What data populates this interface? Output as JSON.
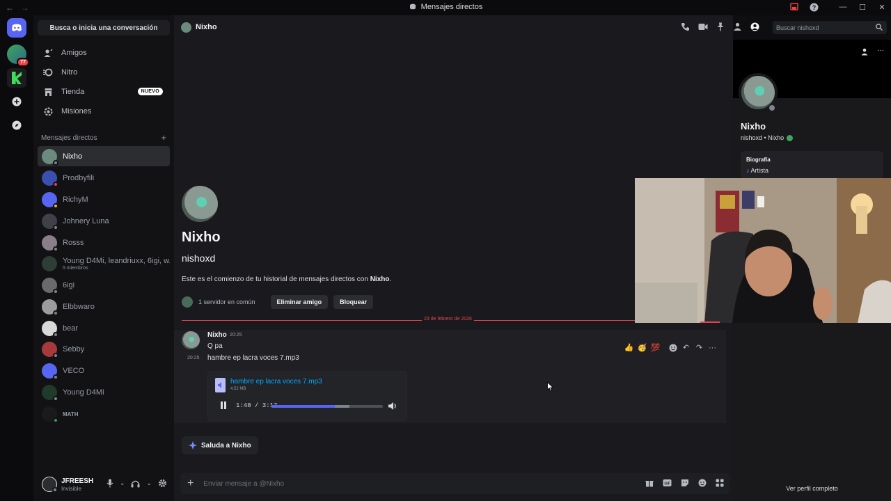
{
  "titlebar": {
    "title": "Mensajes directos"
  },
  "rail": {
    "items": [
      {
        "name": "discord-home",
        "badge": ""
      },
      {
        "name": "server-1",
        "badge": "77"
      },
      {
        "name": "server-2",
        "badge": ""
      },
      {
        "name": "add-server",
        "badge": ""
      },
      {
        "name": "discover",
        "badge": ""
      }
    ]
  },
  "sidebar": {
    "search_label": "Busca o inicia una conversación",
    "nav": [
      {
        "label": "Amigos",
        "icon": "friends-icon"
      },
      {
        "label": "Nitro",
        "icon": "nitro-icon"
      },
      {
        "label": "Tienda",
        "icon": "shop-icon",
        "badge": "NUEVO"
      },
      {
        "label": "Misiones",
        "icon": "quests-icon"
      }
    ],
    "dm_header": "Mensajes directos",
    "dms": [
      {
        "name": "Nixho",
        "sub": "",
        "color": "#6c8b7f",
        "status": "#80848e"
      },
      {
        "name": "Prodbyfili",
        "sub": "",
        "color": "#3a4fb0",
        "status": "#f23f43"
      },
      {
        "name": "RichyM",
        "sub": "",
        "color": "#5865f2",
        "status": "#f0b232"
      },
      {
        "name": "Johnery Luna",
        "sub": "",
        "color": "#404048",
        "status": "#80848e"
      },
      {
        "name": "Rosss",
        "sub": "",
        "color": "#8a7f88",
        "status": "#80848e"
      },
      {
        "name": "Young D4Mi, leandriuxx, 6igi, w...",
        "sub": "5 miembros",
        "color": "#2e3d35",
        "status": ""
      },
      {
        "name": "6igi",
        "sub": "",
        "color": "#6a6a6a",
        "status": "#80848e"
      },
      {
        "name": "Elbbwaro",
        "sub": "",
        "color": "#9c9c9c",
        "status": "#80848e"
      },
      {
        "name": "bear",
        "sub": "",
        "color": "#d8d8d8",
        "status": "#80848e"
      },
      {
        "name": "Sebby",
        "sub": "",
        "color": "#a63a3a",
        "status": "#80848e"
      },
      {
        "name": "VECO",
        "sub": "",
        "color": "#5865f2",
        "status": "#80848e"
      },
      {
        "name": "Young D4Mi",
        "sub": "",
        "color": "#1f3b2c",
        "status": "#80848e"
      },
      {
        "name": "MATH",
        "sub": "",
        "color": "#1a1a1a",
        "status": "#23a55a"
      }
    ]
  },
  "user": {
    "name": "JFREESH",
    "status": "Invisible"
  },
  "header": {
    "channel": "Nixho",
    "search_placeholder": "Buscar nishoxd"
  },
  "intro": {
    "name": "Nixho",
    "handle": "nishoxd",
    "text_before": "Este es el comienzo de tu historial de mensajes directos con ",
    "text_bold": "Nixho",
    "text_after": ".",
    "mutual": "1 servidor en común",
    "remove_friend": "Eliminar amigo",
    "block": "Bloquear"
  },
  "divider_date": "23 de febrero de 2026",
  "message": {
    "author": "Nixho",
    "time": "20:25",
    "line1": "Q pa",
    "time2": "20:25",
    "line2": "hambre ep lacra voces 7.mp3",
    "reactions": [
      "👍",
      "🥳",
      "💯"
    ]
  },
  "attachment": {
    "file_name": "hambre ep lacra voces 7.mp3",
    "file_size": "4.52 MB",
    "time_display": "1:48 / 3:17",
    "progress": 0.57,
    "buffered": 0.7
  },
  "wave_button": "Saluda a Nixho",
  "composer": {
    "placeholder": "Enviar mensaje a @Nixho"
  },
  "profile": {
    "name": "Nixho",
    "sub": "nishoxd • Nixho",
    "bio_title": "Biografía",
    "bio_text": "Artista",
    "full_profile": "Ver perfil completo"
  },
  "colors": {
    "accent": "#5865f2",
    "danger": "#e0454d",
    "link": "#00a8fc"
  }
}
